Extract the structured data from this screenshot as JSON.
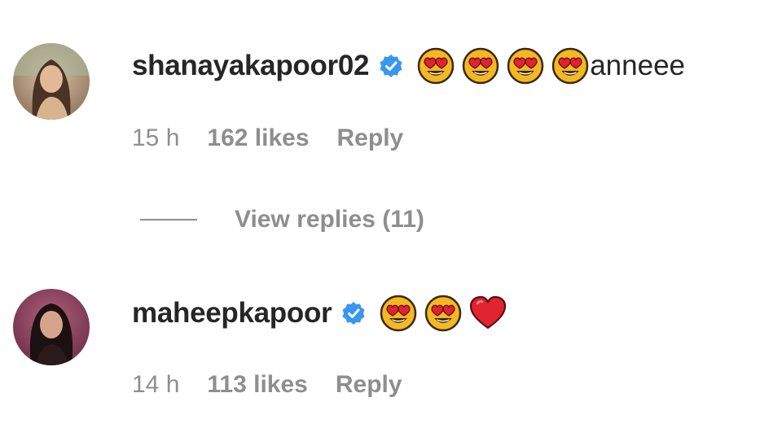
{
  "comments": [
    {
      "username": "shanayakapoor02",
      "verified": true,
      "emojis": [
        "heart-eyes-emoji",
        "heart-eyes-emoji",
        "heart-eyes-emoji",
        "heart-eyes-emoji"
      ],
      "text": "anneee",
      "time": "15 h",
      "likes": "162 likes",
      "reply_label": "Reply",
      "view_replies": "View replies (11)"
    },
    {
      "username": "maheepkapoor",
      "verified": true,
      "emojis": [
        "heart-eyes-emoji",
        "heart-eyes-emoji",
        "red-heart-emoji"
      ],
      "text": "",
      "time": "14 h",
      "likes": "113 likes",
      "reply_label": "Reply"
    }
  ],
  "colors": {
    "text": "#262626",
    "secondary": "#8e8e8e",
    "verified_blue": "#3897f0",
    "emoji_face": "#f5b823",
    "heart_red": "#e0232f"
  }
}
